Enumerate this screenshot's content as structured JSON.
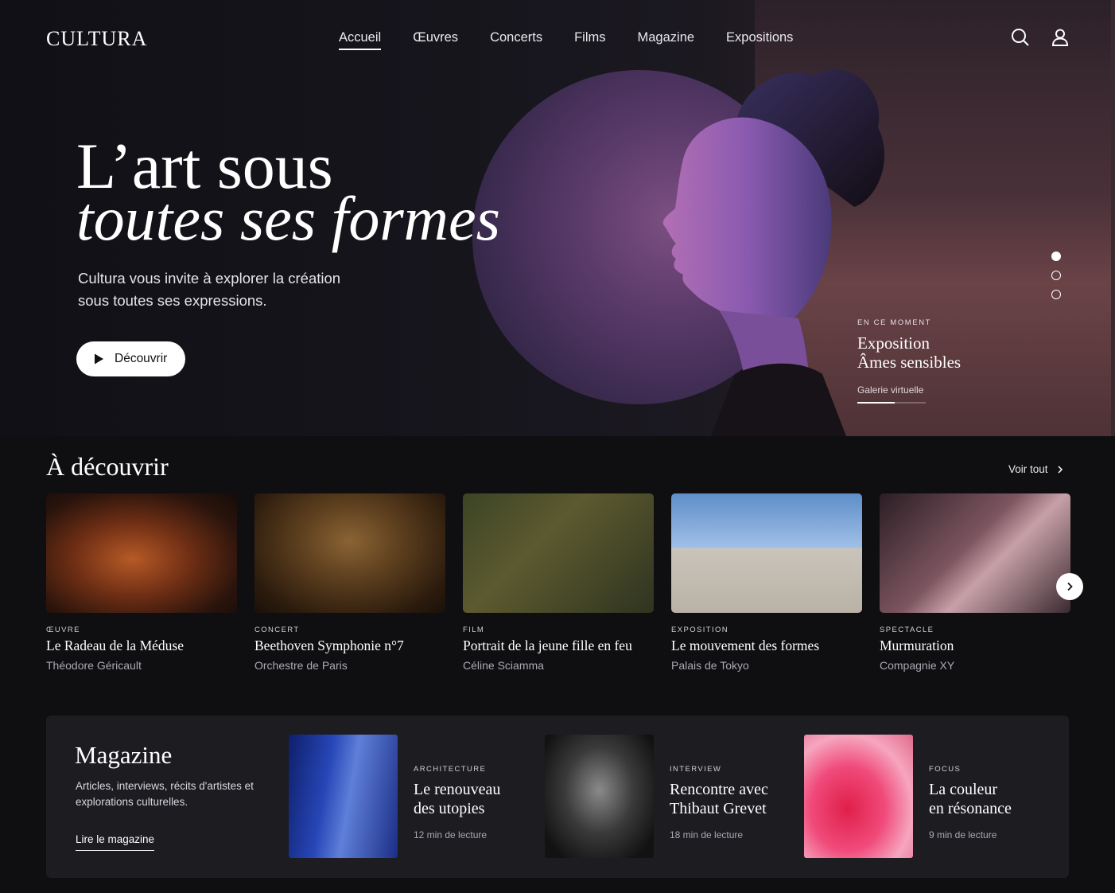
{
  "brand": {
    "logo": "CULTURA"
  },
  "nav": {
    "items": [
      {
        "label": "Accueil",
        "active": true
      },
      {
        "label": "Œuvres",
        "active": false
      },
      {
        "label": "Concerts",
        "active": false
      },
      {
        "label": "Films",
        "active": false
      },
      {
        "label": "Magazine",
        "active": false
      },
      {
        "label": "Expositions",
        "active": false
      }
    ],
    "icons": [
      "search-icon",
      "user-icon"
    ]
  },
  "hero": {
    "title_line1": "L’art sous",
    "title_line2": "toutes ses formes",
    "subtitle": "Cultura vous invite à explorer la création sous toutes ses expressions.",
    "cta_label": "Découvrir",
    "slides_count": 3,
    "active_slide": 1,
    "now": {
      "eyebrow": "EN CE MOMENT",
      "title_line1": "Exposition",
      "title_line2": "Âmes sensibles",
      "subtitle": "Galerie virtuelle",
      "progress": 0.55
    }
  },
  "discover": {
    "title": "À découvrir",
    "see_all": "Voir tout",
    "cards": [
      {
        "category": "ŒUVRE",
        "title": "Le Radeau de la Méduse",
        "subtitle": "Théodore Géricault"
      },
      {
        "category": "CONCERT",
        "title": "Beethoven Symphonie n°7",
        "subtitle": "Orchestre de Paris"
      },
      {
        "category": "FILM",
        "title": "Portrait de la jeune fille en feu",
        "subtitle": "Céline Sciamma"
      },
      {
        "category": "EXPOSITION",
        "title": "Le mouvement des formes",
        "subtitle": "Palais de Tokyo"
      },
      {
        "category": "SPECTACLE",
        "title": "Murmuration",
        "subtitle": "Compagnie XY"
      }
    ]
  },
  "magazine": {
    "title": "Magazine",
    "description": "Articles, interviews, récits d'artistes et explorations culturelles.",
    "link": "Lire le magazine",
    "articles": [
      {
        "category": "ARCHITECTURE",
        "title_line1": "Le renouveau",
        "title_line2": "des utopies",
        "meta": "12 min de lecture"
      },
      {
        "category": "INTERVIEW",
        "title_line1": "Rencontre avec",
        "title_line2": "Thibaut Grevet",
        "meta": "18 min de lecture"
      },
      {
        "category": "FOCUS",
        "title_line1": "La couleur",
        "title_line2": "en résonance",
        "meta": "9 min de lecture"
      }
    ]
  },
  "colors": {
    "background": "#0f0f12",
    "panel": "#1c1c21",
    "accent": "#ffffff"
  }
}
